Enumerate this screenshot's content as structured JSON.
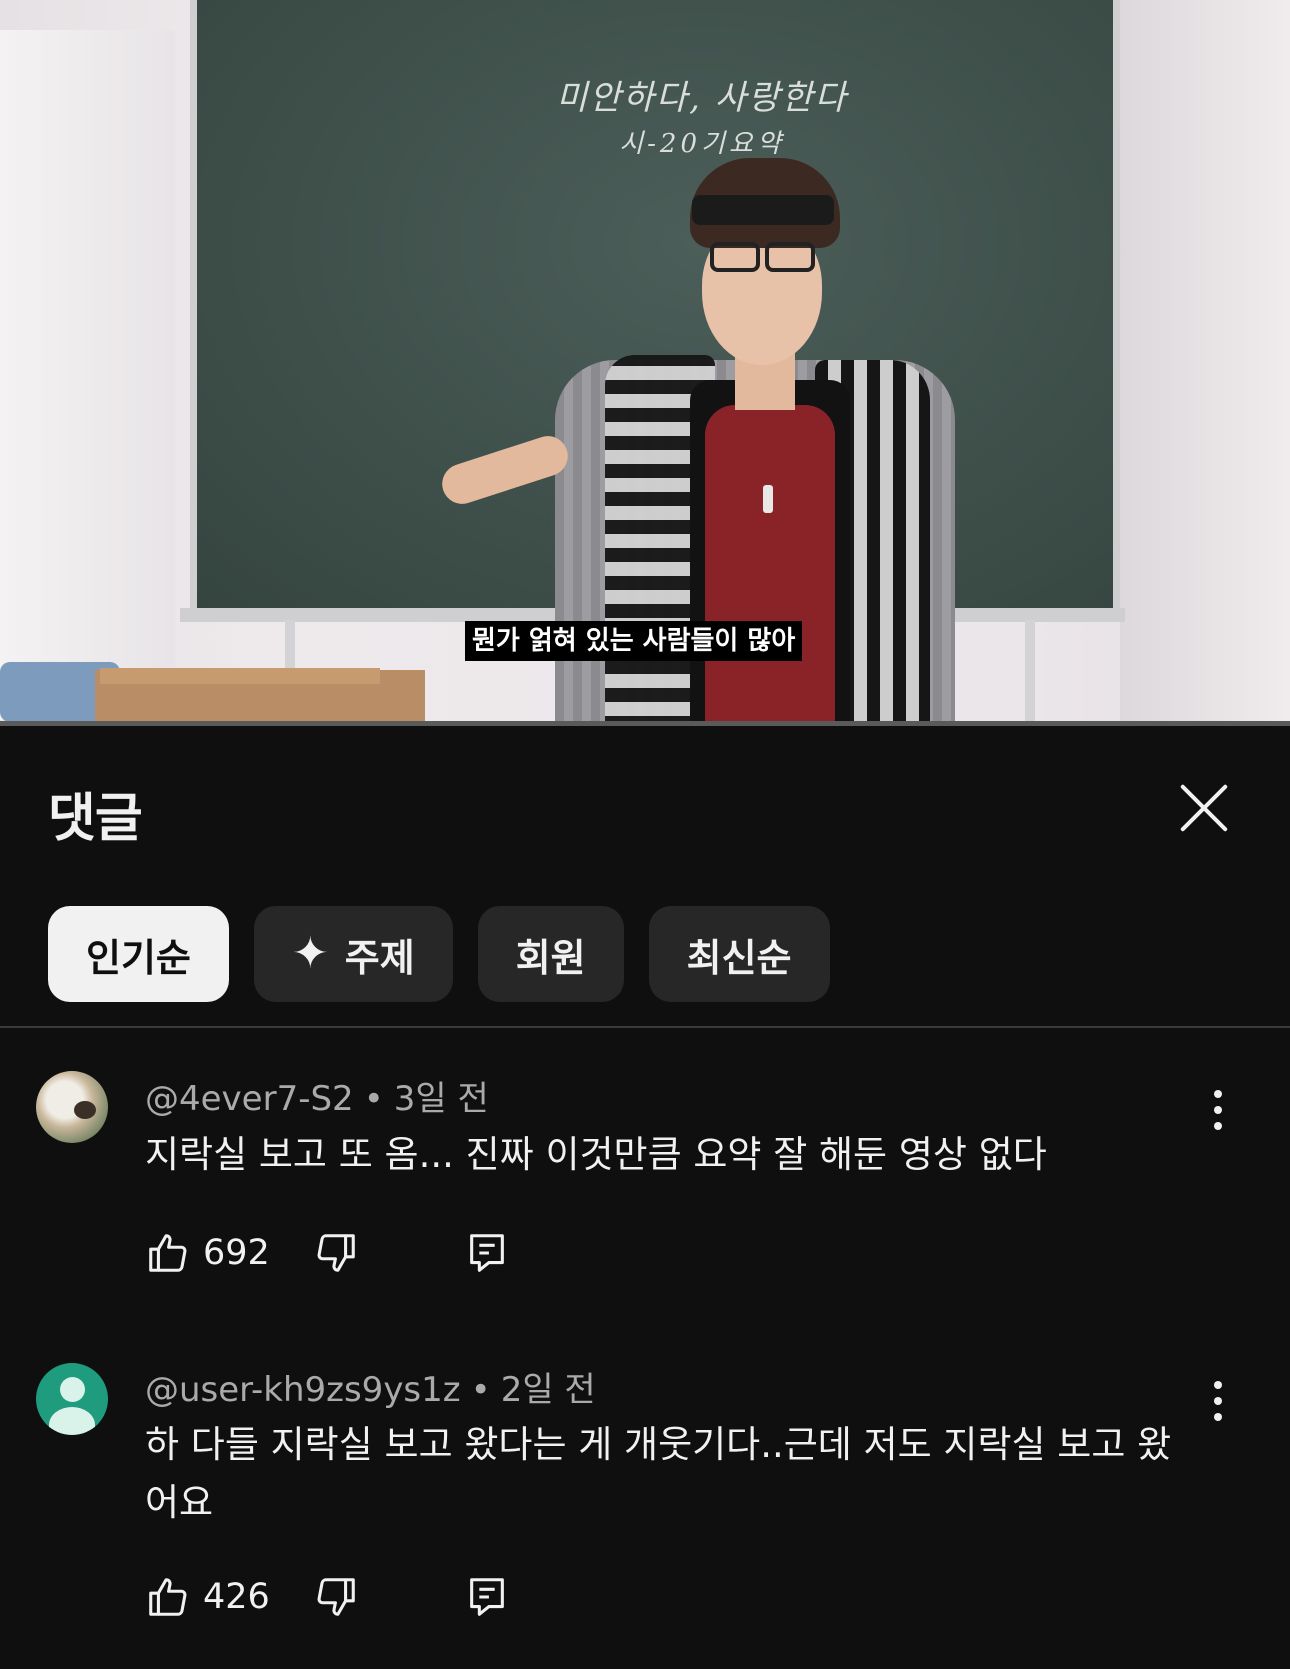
{
  "video": {
    "board_line1": "미안하다, 사랑한다",
    "board_line2": "시-20기요약",
    "subtitle": "뭔가 얽혀 있는 사람들이 많아",
    "progress_fraction": 0.0
  },
  "panel": {
    "title": "댓글",
    "close_icon": "close-icon"
  },
  "chips": [
    {
      "label": "인기순",
      "active": true
    },
    {
      "label": "주제",
      "icon": "sparkle-icon",
      "active": false
    },
    {
      "label": "회원",
      "active": false
    },
    {
      "label": "최신순",
      "active": false
    }
  ],
  "chip_sparkle": "✦",
  "comments": [
    {
      "author": "@4ever7-S2",
      "dot": "•",
      "time": "3일 전",
      "text": "지락실 보고 또 옴... 진짜 이것만큼 요약 잘 해둔 영상 없다",
      "likes": "692",
      "avatar": "custom-photo"
    },
    {
      "author": "@user-kh9zs9ys1z",
      "dot": "•",
      "time": "2일 전",
      "text": "하 다들 지락실 보고 왔다는 게 개웃기다..근데 저도 지락실 보고 왔어요",
      "likes": "426",
      "avatar": "default-avatar"
    }
  ],
  "colors": {
    "background": "#0f0f0f",
    "chip_bg": "#272727",
    "chip_active_bg": "#f1f1f1",
    "meta_text": "#aaaaaa",
    "default_avatar": "#1f9b7e"
  }
}
